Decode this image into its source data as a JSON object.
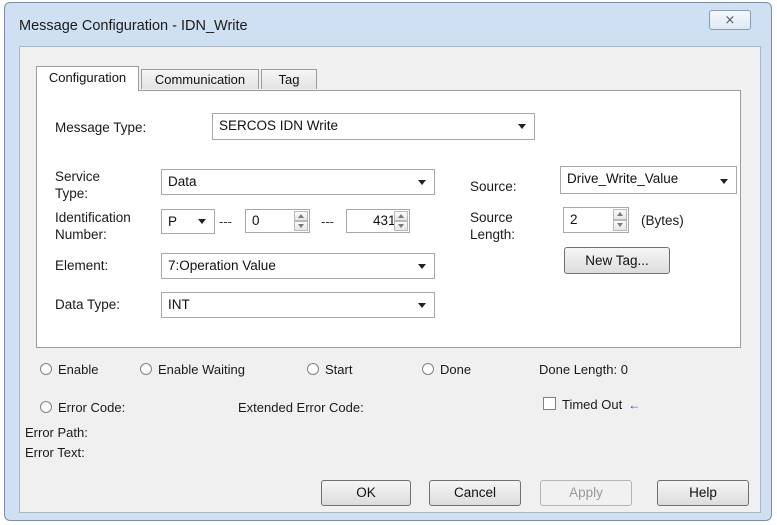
{
  "window": {
    "title": "Message Configuration - IDN_Write",
    "close_glyph": "⨯"
  },
  "tabs": [
    {
      "label": "Configuration",
      "active": true
    },
    {
      "label": "Communication",
      "active": false
    },
    {
      "label": "Tag",
      "active": false
    }
  ],
  "config": {
    "message_type_label": "Message Type:",
    "message_type_value": "SERCOS IDN Write",
    "service_type_label": "Service\nType:",
    "service_type_value": "Data",
    "identification_label": "Identification\nNumber:",
    "id_prefix_value": "P",
    "id_separator": "---",
    "id_set_value": "0",
    "id_number_value": "431",
    "element_label": "Element:",
    "element_value": "7:Operation Value",
    "data_type_label": "Data Type:",
    "data_type_value": "INT",
    "source_label": "Source:",
    "source_value": "Drive_Write_Value",
    "source_length_label": "Source\nLength:",
    "source_length_value": "2",
    "bytes_label": "(Bytes)",
    "new_tag_label": "New Tag..."
  },
  "status": {
    "enable": "Enable",
    "enable_waiting": "Enable Waiting",
    "start": "Start",
    "done": "Done",
    "done_length_label": "Done Length:",
    "done_length_value": "0",
    "error_code": "Error Code:",
    "extended_error_code": "Extended Error Code:",
    "timed_out": "Timed Out",
    "timed_out_marker": "←",
    "error_path": "Error Path:",
    "error_text": "Error Text:"
  },
  "buttons": {
    "ok": "OK",
    "cancel": "Cancel",
    "apply": "Apply",
    "help": "Help"
  }
}
